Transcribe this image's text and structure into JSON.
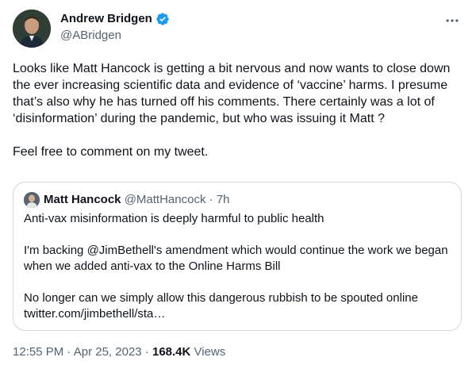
{
  "author": {
    "name": "Andrew Bridgen",
    "handle": "@ABridgen",
    "verified_color": "#1d9bf0"
  },
  "tweet": {
    "text": "Looks like Matt Hancock is getting a bit nervous and now wants to close down the ever increasing scientific data and evidence of ‘vaccine’ harms. I presume that’s also why he has turned off his comments. There certainly was a lot of ‘disinformation’ during the pandemic, but who was issuing it Matt ?\n\nFeel free to comment on my tweet."
  },
  "quoted": {
    "name": "Matt Hancock",
    "handle": "@MattHancock",
    "separator": " · ",
    "time": "7h",
    "text": "Anti-vax misinformation is deeply harmful to public health\n\nI'm backing @JimBethell's amendment which would continue the work we began when we added anti-vax to the Online Harms Bill\n\nNo longer can we simply allow this dangerous rubbish to be spouted online\ntwitter.com/jimbethell/sta…"
  },
  "footer": {
    "time": "12:55 PM",
    "separator": " · ",
    "date": "Apr 25, 2023",
    "views_count": "168.4K",
    "views_label": " Views"
  },
  "icons": {
    "more": "more-horizontal-icon",
    "verified": "verified-badge-icon"
  },
  "colors": {
    "text": "#0f1419",
    "secondary": "#536471",
    "border": "#cfd9de",
    "accent": "#1d9bf0"
  }
}
